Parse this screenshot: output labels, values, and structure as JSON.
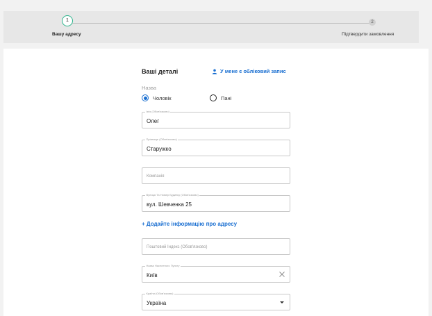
{
  "stepper": {
    "step1": {
      "number": "1",
      "label": "Вашу адресу"
    },
    "step2": {
      "number": "2",
      "label": "Підтвердити замовлення"
    }
  },
  "details": {
    "title": "Ваші деталі",
    "account_link": "У мене є обліковий запис",
    "salutation_label": "Назва",
    "salutation_options": [
      {
        "label": "Чоловік",
        "selected": true
      },
      {
        "label": "Пані",
        "selected": false
      }
    ]
  },
  "fields": {
    "first_name": {
      "legend": "Ім'я (Обов'язково)",
      "value": "Олег"
    },
    "last_name": {
      "legend": "Прізвище (Обов'язково)",
      "value": "Старужко"
    },
    "company": {
      "placeholder": "Компанія"
    },
    "street": {
      "legend": "Вулиця Та Номер Будинку (Обов'язково)",
      "value": "вул. Шевченка 25"
    },
    "add_address_info": "+ Додайте інформацію про адресу",
    "postal_code": {
      "placeholder": "Поштовий Індекс (Обов'язково)"
    },
    "city": {
      "legend": "Назва Населеного Пункту",
      "value": "Київ"
    },
    "country": {
      "legend": "Країни (Обов'язково)",
      "value": "Україна"
    }
  },
  "colors": {
    "accent": "#1a6fd1",
    "step_active": "#2cb48c"
  }
}
